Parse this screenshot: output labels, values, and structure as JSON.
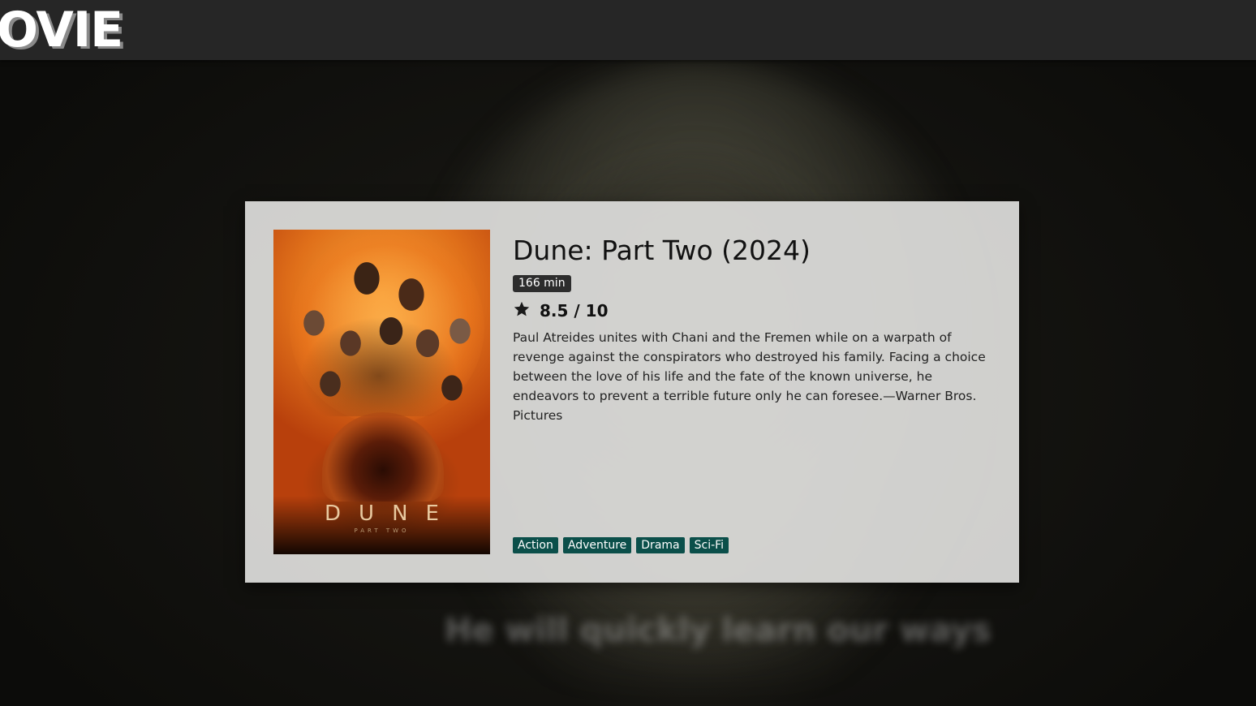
{
  "app": {
    "logo_text": "OVIE"
  },
  "background": {
    "subtitle_text": "He will quickly learn our ways"
  },
  "movie": {
    "title": "Dune: Part Two (2024)",
    "runtime": "166 min",
    "rating": "8.5 / 10",
    "overview": "Paul Atreides unites with Chani and the Fremen while on a warpath of revenge against the conspirators who destroyed his family. Facing a choice between the love of his life and the fate of the known universe, he endeavors to prevent a terrible future only he can foresee.—Warner Bros. Pictures",
    "poster": {
      "title": "DUNE",
      "subtitle": "PART TWO"
    },
    "genres": [
      "Action",
      "Adventure",
      "Drama",
      "Sci-Fi"
    ]
  },
  "icons": {
    "rating": "star-icon"
  },
  "colors": {
    "header_bg": "#262626",
    "card_bg": "#dadad8",
    "genre_tag_bg": "#0b4f4a",
    "runtime_badge_bg": "#2d2d2d"
  }
}
